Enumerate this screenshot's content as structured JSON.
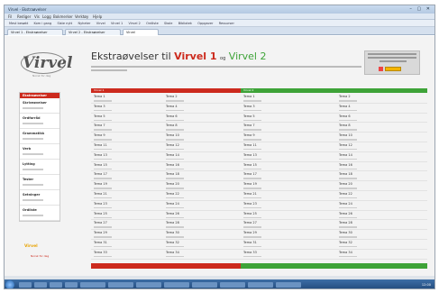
{
  "browser": {
    "window_title": "Virvel - Ekstraøvelser",
    "window_controls": "– ▢ ✕",
    "menu": [
      "Fil",
      "Rediger",
      "Vis",
      "Logg",
      "Bokmerker",
      "Verktøy",
      "Hjelp"
    ],
    "bookmarks": [
      "Mest besøkt",
      "Kom i gang",
      "Siste nytt",
      "Nyheter",
      "Virvel",
      "Virvel 1",
      "Virvel 2",
      "Ordliste",
      "Skole",
      "Bibliotek",
      "Oppgaver",
      "Ressurser"
    ],
    "tabs": [
      {
        "label": "Virvel 1 - Ekstraøvelser",
        "active": false
      },
      {
        "label": "Virvel 2 - Ekstraøvelser",
        "active": false
      },
      {
        "label": "Virvel",
        "active": true
      }
    ]
  },
  "page": {
    "logo": {
      "word": "Virvel",
      "sub": "Norsk for deg"
    },
    "heading": {
      "prefix": "Ekstraøvelser til ",
      "v1": "Virvel 1",
      "sep": "og",
      "v2": "Virvel 2"
    },
    "nav": {
      "head": "Ekstraøvelser",
      "items": [
        "Skriveøvelser",
        "Ordforråd",
        "Grammatikk",
        "Verb",
        "Lytting",
        "Tester",
        "Setninger",
        "Ordliste"
      ]
    },
    "promo2": "Virvel",
    "promo2b": "Norsk for deg",
    "grid": {
      "left_title": "Virvel 1",
      "right_title": "Virvel 2",
      "rows": [
        [
          "Tema 1",
          "Tema 2",
          "Tema 1",
          "Tema 2"
        ],
        [
          "Tema 3",
          "Tema 4",
          "Tema 3",
          "Tema 4"
        ],
        [
          "Tema 5",
          "Tema 6",
          "Tema 5",
          "Tema 6"
        ],
        [
          "Tema 7",
          "Tema 8",
          "Tema 7",
          "Tema 8"
        ],
        [
          "Tema 9",
          "Tema 10",
          "Tema 9",
          "Tema 10"
        ],
        [
          "Tema 11",
          "Tema 12",
          "Tema 11",
          "Tema 12"
        ],
        [
          "Tema 13",
          "Tema 14",
          "Tema 13",
          "Tema 14"
        ],
        [
          "Tema 15",
          "Tema 16",
          "Tema 15",
          "Tema 16"
        ],
        [
          "Tema 17",
          "Tema 18",
          "Tema 17",
          "Tema 18"
        ],
        [
          "Tema 19",
          "Tema 20",
          "Tema 19",
          "Tema 20"
        ],
        [
          "Tema 21",
          "Tema 22",
          "Tema 21",
          "Tema 22"
        ],
        [
          "Tema 23",
          "Tema 24",
          "Tema 23",
          "Tema 24"
        ],
        [
          "Tema 25",
          "Tema 26",
          "Tema 25",
          "Tema 26"
        ],
        [
          "Tema 27",
          "Tema 28",
          "Tema 27",
          "Tema 28"
        ],
        [
          "Tema 29",
          "Tema 30",
          "Tema 29",
          "Tema 30"
        ],
        [
          "Tema 31",
          "Tema 32",
          "Tema 31",
          "Tema 32"
        ],
        [
          "Tema 33",
          "Tema 34",
          "Tema 33",
          "Tema 34"
        ]
      ]
    }
  },
  "taskbar": {
    "clock": "12:00"
  },
  "colors": {
    "accent_red": "#cc2a1d",
    "accent_green": "#3ea338"
  }
}
